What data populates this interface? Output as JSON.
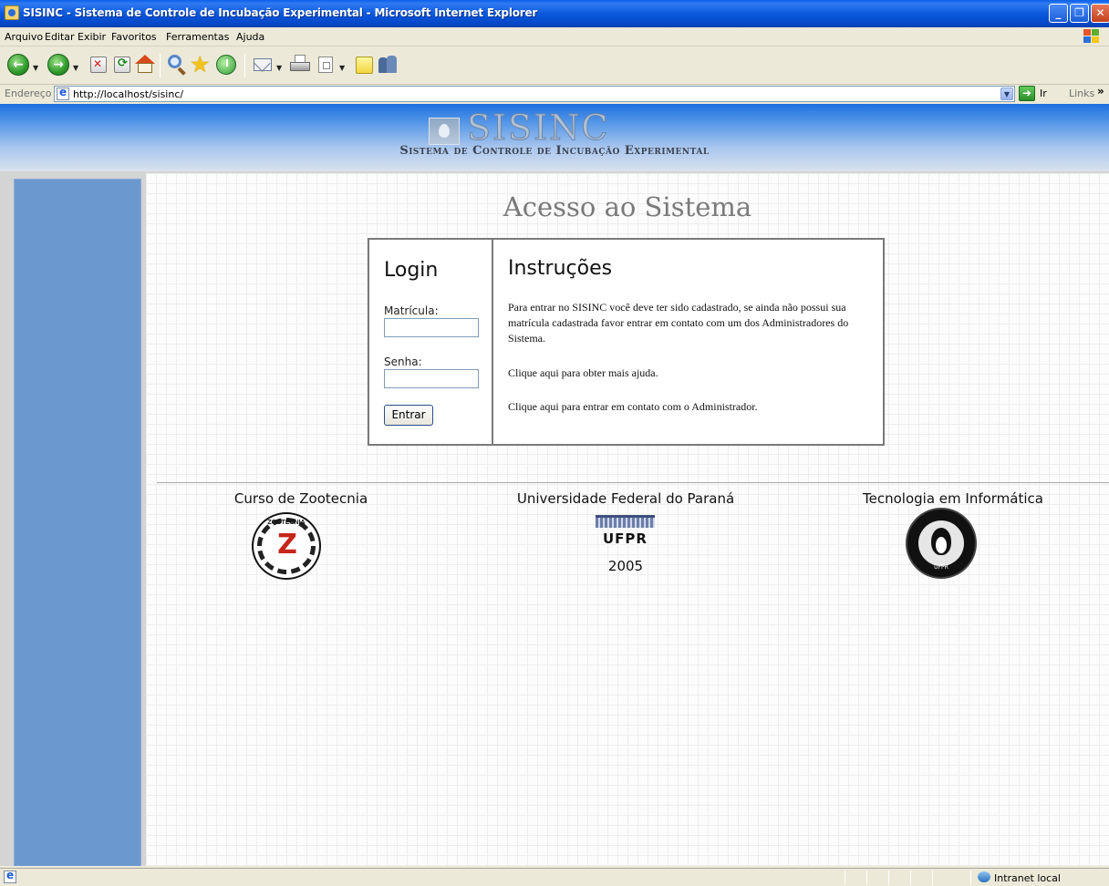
{
  "window": {
    "title": "SISINC - Sistema de Controle de Incubação Experimental - Microsoft Internet Explorer",
    "controls": [
      "_",
      "❐",
      "✕"
    ]
  },
  "menu": {
    "items": [
      "Arquivo",
      "Editar",
      "Exibir",
      "Favoritos",
      "Ferramentas",
      "Ajuda"
    ]
  },
  "toolbar": {
    "buttons": [
      "back-icon",
      "forward-icon",
      "stop-icon",
      "refresh-icon",
      "home-icon",
      "search-icon",
      "favorites-icon",
      "history-icon",
      "mail-icon",
      "print-icon",
      "edit-icon",
      "notes-icon",
      "messenger-icon"
    ]
  },
  "address": {
    "label": "Endereço",
    "url": "http://localhost/sisinc/",
    "go_label": "Ir",
    "links_label": "Links",
    "links_chevron": "»"
  },
  "banner": {
    "logo_text": "SISINC",
    "subtitle": "Sistema de Controle de Incubação Experimental"
  },
  "page": {
    "title": "Acesso ao Sistema"
  },
  "login": {
    "title": "Login",
    "matricula_label": "Matrícula:",
    "matricula_value": "",
    "senha_label": "Senha:",
    "senha_value": "",
    "submit_label": "Entrar"
  },
  "instructions": {
    "title": "Instruções",
    "paragraphs": [
      "Para entrar no SISINC você deve ter sido cadastrado, se ainda não possui sua matrícula cadastrada favor entrar em contato com um dos Administradores do Sistema.",
      "Clique aqui para obter mais ajuda.",
      "Clique aqui para entrar em contato com o Administrador."
    ]
  },
  "footer": {
    "col1_title": "Curso de Zootecnia",
    "col1_seal_text": "ZOOTECNIA",
    "col1_seal_letter": "Z",
    "col2_title": "Universidade Federal do Paraná",
    "col2_logo_text": "UFPR",
    "col2_year": "2005",
    "col3_title": "Tecnologia em Informática",
    "col3_seal_text": "UFPR"
  },
  "status": {
    "zone": "Intranet local"
  }
}
